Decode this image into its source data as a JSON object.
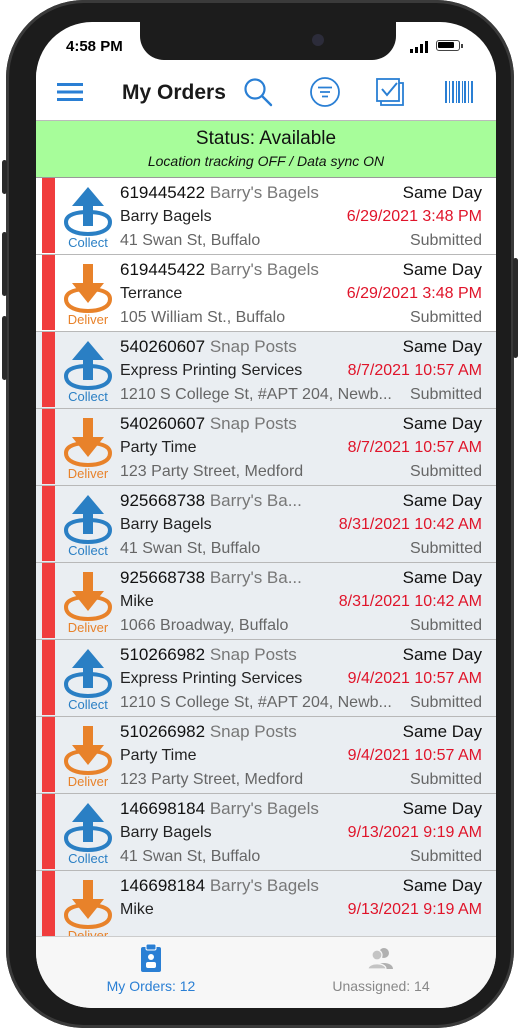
{
  "status_bar": {
    "time": "4:58 PM"
  },
  "navbar": {
    "title": "My Orders",
    "icons": [
      "menu-icon",
      "search-icon",
      "filter-icon",
      "checkbox-icon",
      "barcode-icon"
    ],
    "accent": "#2a7fd4"
  },
  "banner": {
    "title": "Status: Available",
    "subtitle": "Location tracking OFF / Data sync ON",
    "color": "#a7fd9a"
  },
  "orders": [
    {
      "type": "Collect",
      "number": "619445422",
      "name": "Barry's Bagels",
      "contact": "Barry Bagels",
      "address": "41 Swan St, Buffalo",
      "service": "Same Day",
      "datetime": "6/29/2021 3:48 PM",
      "status": "Submitted"
    },
    {
      "type": "Deliver",
      "number": "619445422",
      "name": "Barry's Bagels",
      "contact": "Terrance",
      "address": "105 William St., Buffalo",
      "service": "Same Day",
      "datetime": "6/29/2021 3:48 PM",
      "status": "Submitted"
    },
    {
      "type": "Collect",
      "number": "540260607",
      "name": "Snap Posts",
      "contact": "Express Printing Services",
      "address": "1210 S College St, #APT 204, Newb...",
      "service": "Same Day",
      "datetime": "8/7/2021 10:57 AM",
      "status": "Submitted"
    },
    {
      "type": "Deliver",
      "number": "540260607",
      "name": "Snap Posts",
      "contact": "Party Time",
      "address": "123 Party Street, Medford",
      "service": "Same Day",
      "datetime": "8/7/2021 10:57 AM",
      "status": "Submitted"
    },
    {
      "type": "Collect",
      "number": "925668738",
      "name": "Barry's Ba...",
      "contact": "Barry Bagels",
      "address": "41 Swan St, Buffalo",
      "service": "Same Day",
      "datetime": "8/31/2021 10:42 AM",
      "status": "Submitted"
    },
    {
      "type": "Deliver",
      "number": "925668738",
      "name": "Barry's Ba...",
      "contact": "Mike",
      "address": "1066 Broadway, Buffalo",
      "service": "Same Day",
      "datetime": "8/31/2021 10:42 AM",
      "status": "Submitted"
    },
    {
      "type": "Collect",
      "number": "510266982",
      "name": "Snap Posts",
      "contact": "Express Printing Services",
      "address": "1210 S College St, #APT 204, Newb...",
      "service": "Same Day",
      "datetime": "9/4/2021 10:57 AM",
      "status": "Submitted"
    },
    {
      "type": "Deliver",
      "number": "510266982",
      "name": "Snap Posts",
      "contact": "Party Time",
      "address": "123 Party Street, Medford",
      "service": "Same Day",
      "datetime": "9/4/2021 10:57 AM",
      "status": "Submitted"
    },
    {
      "type": "Collect",
      "number": "146698184",
      "name": "Barry's Bagels",
      "contact": "Barry Bagels",
      "address": "41 Swan St, Buffalo",
      "service": "Same Day",
      "datetime": "9/13/2021 9:19 AM",
      "status": "Submitted"
    },
    {
      "type": "Deliver",
      "number": "146698184",
      "name": "Barry's Bagels",
      "contact": "Mike",
      "address": "",
      "service": "Same Day",
      "datetime": "9/13/2021 9:19 AM",
      "status": ""
    }
  ],
  "colors": {
    "collect": "#2a7fc4",
    "deliver": "#e8822a",
    "priority_strip": "#f03d3d",
    "date_red": "#e0142a"
  },
  "tabbar": {
    "my_orders": "My Orders: 12",
    "unassigned": "Unassigned: 14"
  }
}
